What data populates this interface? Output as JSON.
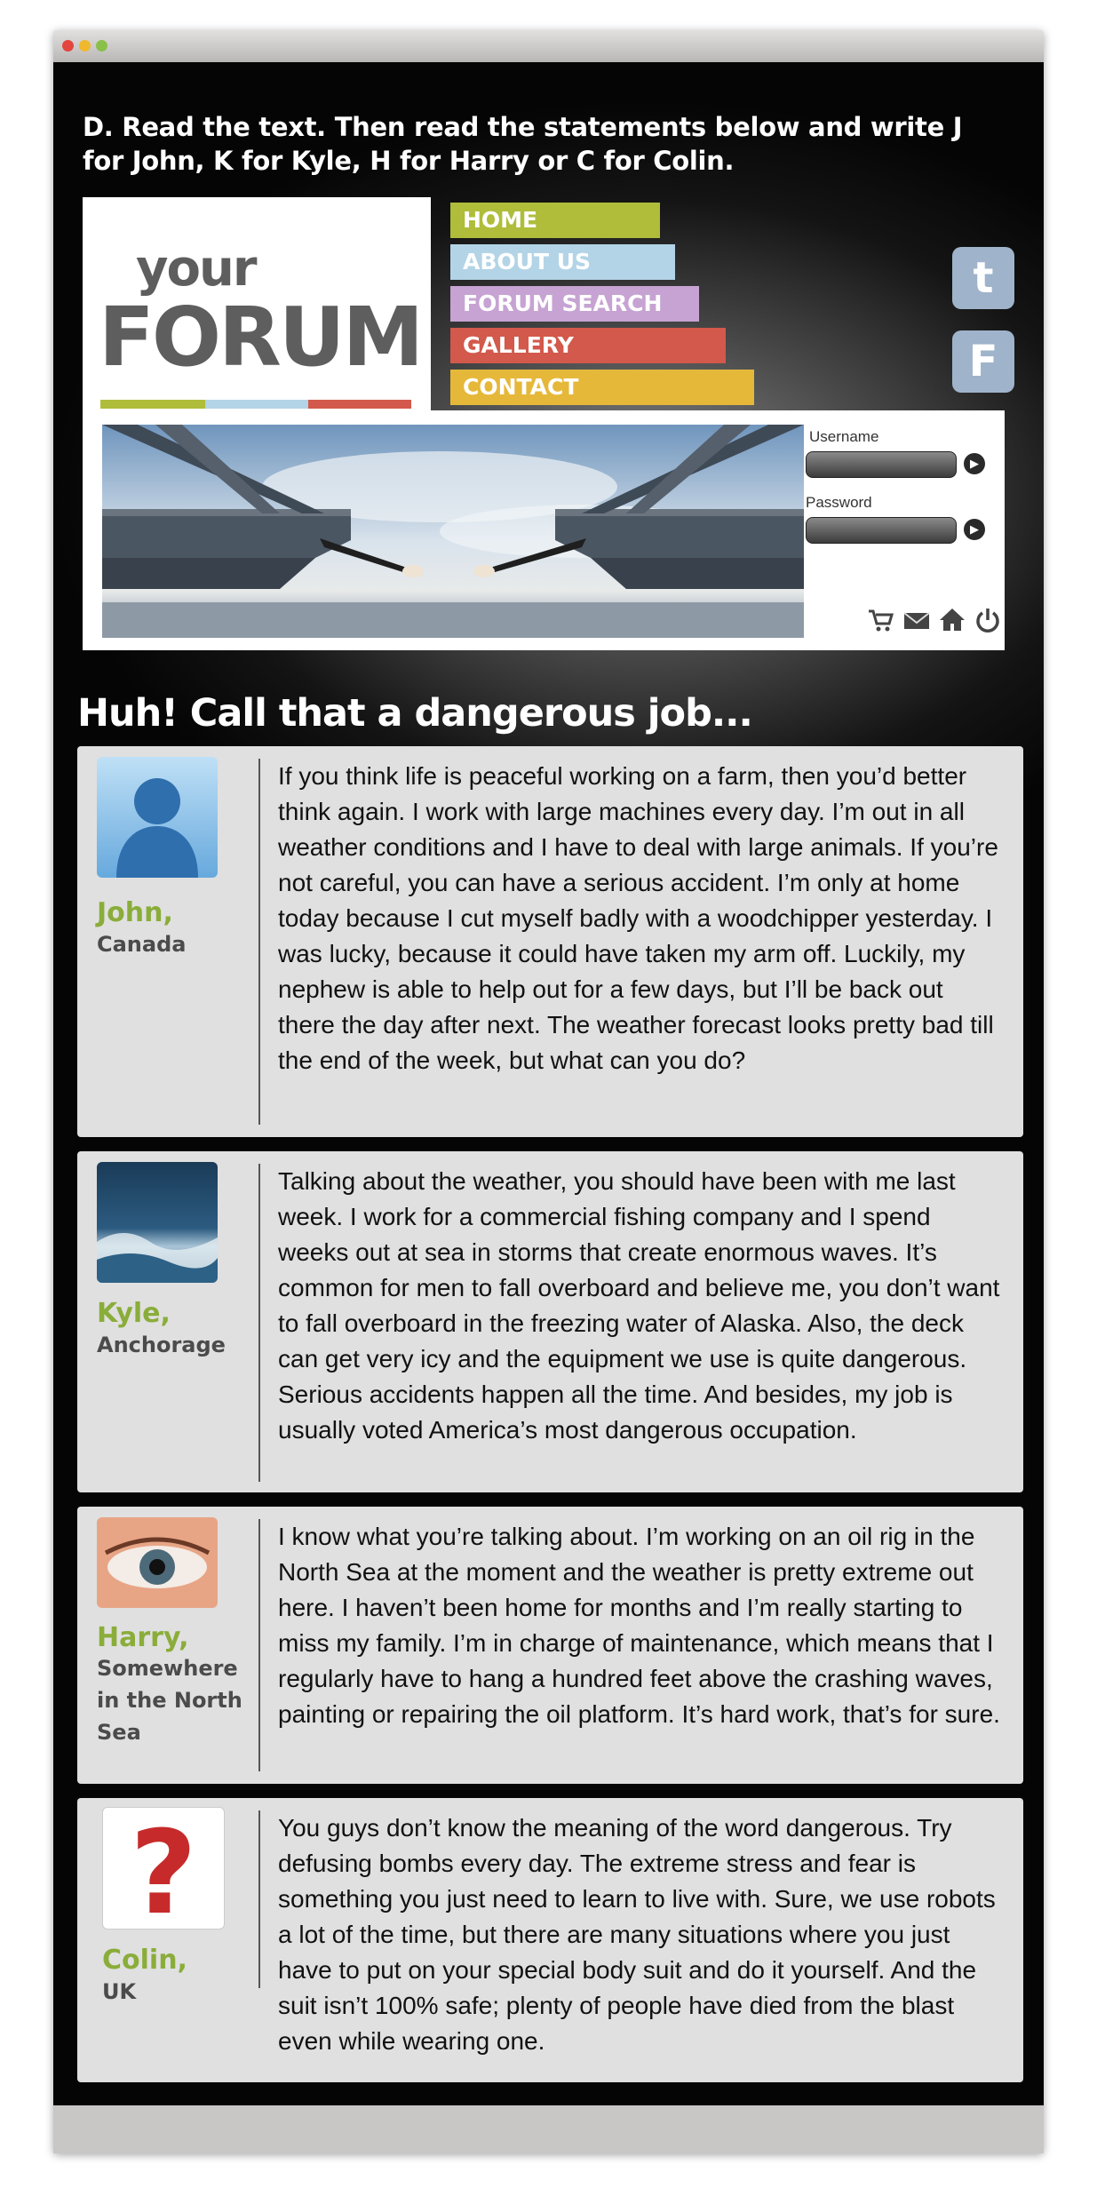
{
  "instruction": "D.  Read the text. Then read the statements below and write J for John, K for Kyle, H for Harry or C for Colin.",
  "logo": {
    "top": "your",
    "bottom": "FORUM"
  },
  "nav": [
    {
      "label": "HOME",
      "color": "#afbd3a"
    },
    {
      "label": "ABOUT US",
      "color": "#b3d4e6"
    },
    {
      "label": "FORUM SEARCH",
      "color": "#c6a3d2"
    },
    {
      "label": "GALLERY",
      "color": "#d2594b"
    },
    {
      "label": "CONTACT",
      "color": "#e6b83a"
    }
  ],
  "social": {
    "tumblr": "t",
    "facebook": "F"
  },
  "login": {
    "username_label": "Username",
    "password_label": "Password"
  },
  "heading": "Huh! Call that a dangerous job...",
  "posts": [
    {
      "name": "John,",
      "location": "Canada",
      "avatar": "person-silhouette-icon",
      "text": "If you think life is peaceful working on a farm, then you’d better think again. I work with large machines every day. I’m out in all weather conditions and I have to deal with large animals. If you’re not careful, you can have a serious accident. I’m only at home today because I cut myself badly with a woodchipper yesterday. I was lucky, because it could have taken my arm off. Luckily, my nephew is able to help out for a few days, but I’ll be back out there the day after next. The weather forecast looks pretty bad till the end of the week, but what can you do?"
    },
    {
      "name": "Kyle,",
      "location": "Anchorage",
      "avatar": "stormy-sea-image",
      "text": "Talking about the weather, you should have been with me last week. I work for a commercial fishing company and I spend weeks out at sea in storms that create enormous waves. It’s common for men to fall overboard and believe me, you don’t want to fall overboard in the freezing water of Alaska. Also, the deck can get very icy and the equipment we use is quite dangerous. Serious accidents happen all the time. And besides, my job is usually voted America’s most dangerous occupation."
    },
    {
      "name": "Harry,",
      "location": "Somewhere in the North Sea",
      "avatar": "eye-image",
      "text": "I know what you’re talking about. I’m working on an oil rig in the North Sea at the moment and the weather is pretty extreme out here. I haven’t been home for months and I’m really starting to miss my family. I’m in charge of maintenance, which means that I regularly have to hang a hundred feet above the crashing waves, painting or repairing the oil platform. It’s hard work, that’s for sure."
    },
    {
      "name": "Colin,",
      "location": "UK",
      "avatar": "question-mark-icon",
      "text": "You guys don’t know the meaning of the word dangerous. Try defusing bombs every day. The extreme stress and fear is something you just need to learn to live with. Sure, we use robots a lot of the time, but there are many situations where you just have to put on your special body suit and do it yourself. And the suit isn’t 100% safe; plenty of people have died from the blast even while wearing one."
    }
  ]
}
